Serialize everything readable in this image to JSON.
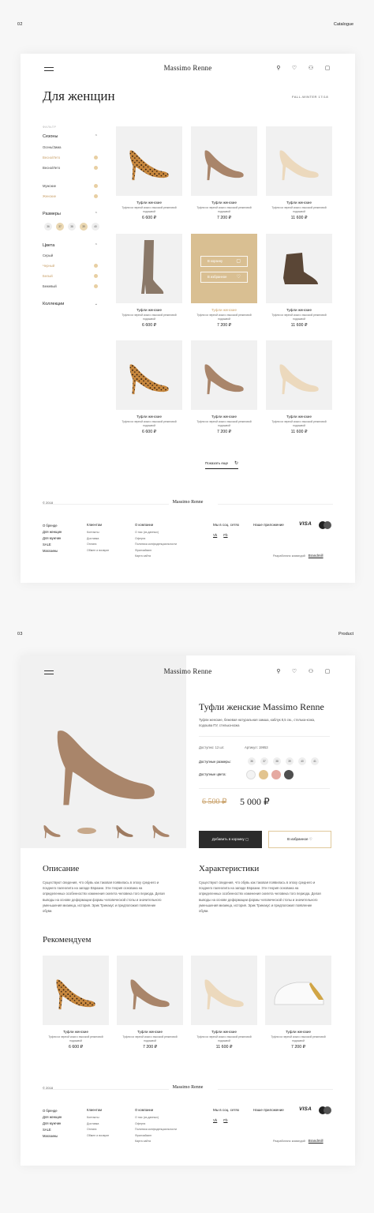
{
  "page1": {
    "num": "02",
    "name": "Catalogue"
  },
  "page2": {
    "num": "03",
    "name": "Product"
  },
  "brand": "Massimo Renne",
  "catalogue": {
    "title": "Для женщин",
    "season": "FALL-WINTER 17/18",
    "filter_label": "ФИЛЬТР",
    "groups": {
      "seasons": "Сезоны",
      "season_opts": [
        "Осень/Зима",
        "Весна/Лето",
        "Весна/Лето"
      ],
      "gender_opts": [
        "Мужские",
        "Женские"
      ],
      "sizes": "Размеры",
      "size_opts": [
        "36",
        "37",
        "38",
        "39",
        "40"
      ],
      "colors": "Цвета",
      "color_opts": [
        "Серый",
        "Черный",
        "Белый",
        "Бежевый"
      ],
      "collections": "Коллекции"
    },
    "products": [
      {
        "name": "Туфли женские",
        "desc": "Туфли из черной кожи с высокой резиновой подошвой",
        "price": "6 600 ₽"
      },
      {
        "name": "Туфли женские",
        "desc": "Туфли из черной кожи с высокой резиновой подошвой",
        "price": "7 200 ₽"
      },
      {
        "name": "Туфли женские",
        "desc": "Туфли из черной кожи с высокой резиновой подошвой",
        "price": "11 600 ₽"
      },
      {
        "name": "Туфли женские",
        "desc": "Туфли из черной кожи с высокой резиновой подошвой",
        "price": "6 600 ₽"
      },
      {
        "name": "Туфли женские",
        "desc": "Туфли из черной кожи с высокой резиновой подошвой",
        "price": "7 200 ₽"
      },
      {
        "name": "Туфли женские",
        "desc": "Туфли из черной кожи с высокой резиновой подошвой",
        "price": "11 600 ₽"
      },
      {
        "name": "Туфли женские",
        "desc": "Туфли из черной кожи с высокой резиновой подошвой",
        "price": "6 600 ₽"
      },
      {
        "name": "Туфли женские",
        "desc": "Туфли из черной кожи с высокой резиновой подошвой",
        "price": "7 200 ₽"
      },
      {
        "name": "Туфли женские",
        "desc": "Туфли из черной кожи с высокой резиновой подошвой",
        "price": "11 600 ₽"
      }
    ],
    "hover_cart": "В корзину",
    "hover_fav": "В избранное",
    "show_more": "Показать еще"
  },
  "footer": {
    "copy": "© 2018",
    "col1": [
      "О бренде",
      "Для женщин",
      "Для мужчин",
      "SALE",
      "Магазины"
    ],
    "col2_head": "Клиентам",
    "col2": [
      "Контакты",
      "Доставка",
      "Оплата",
      "Обмен и возврат"
    ],
    "col3_head": "О компании",
    "col3": [
      "О нас (из данных)",
      "Оферта",
      "Политика конфиденциальности",
      "Франчайзинг",
      "Карта сайта"
    ],
    "social_head": "Мы в соц. сетях",
    "social": [
      "Vk",
      "Fb"
    ],
    "pay_head": "Наше приложение",
    "visa": "VISA",
    "dev": "Разработано командой",
    "dev_name": "Brandmill"
  },
  "product": {
    "title": "Туфли женские Massimo Renne",
    "desc": "Туфли женские, бежевая натуральная замша, каблук 8,5 см., стелька-кожа, подошва ПУ, стелька-кожа",
    "stock_label": "Доступно:",
    "stock": "12 шт.",
    "art_label": "Артикул:",
    "art": "19953",
    "sizes_label": "Доступные размеры:",
    "sizes": [
      "36",
      "37",
      "38",
      "39",
      "40",
      "41"
    ],
    "colors_label": "Доступные цвета:",
    "colors": [
      "#f3f3f3",
      "#e2c48f",
      "#e5a9a1",
      "#4f4f4f"
    ],
    "old_price": "6 500 ₽",
    "price": "5 000 ₽",
    "cart": "Добавить в корзину",
    "fav": "В избранное",
    "desc_title": "Описание",
    "desc_text": "Существуют сведения, что обувь как таковая появилась в эпоху среднего и позднего палеолита на западе Евразии. Эти теория основана на определенных особенностях изменения скелета человека того периода. Делая выводы на основе деформации формы человеческой стопы и значительного уменьшения мизинца, история. Эрик Тринакус и предположил появление обуви.",
    "char_title": "Характеристики",
    "char_text": "Существуют сведения, что обувь как таковая появилась в эпоху среднего и позднего палеолита на западе Евразии. Эти теория основана на определенных особенностях изменения скелета человека того периода. Делая выводы на основе деформации формы человеческой стопы и значительного уменьшения мизинца, история. Эрик Тринакус и предположил появление обуви.",
    "rec_title": "Рекомендуем",
    "rec": [
      {
        "name": "Туфли женские",
        "desc": "Туфли из черной кожи с высокой резиновой подошвой",
        "price": "6 600 ₽"
      },
      {
        "name": "Туфли женские",
        "desc": "Туфли из черной кожи с высокой резиновой подошвой",
        "price": "7 200 ₽"
      },
      {
        "name": "Туфли женские",
        "desc": "Туфли из черной кожи с высокой резиновой подошвой",
        "price": "11 600 ₽"
      },
      {
        "name": "Туфли женские",
        "desc": "Туфли из черной кожи с высокой резиновой подошвой",
        "price": "7 200 ₽"
      }
    ]
  }
}
